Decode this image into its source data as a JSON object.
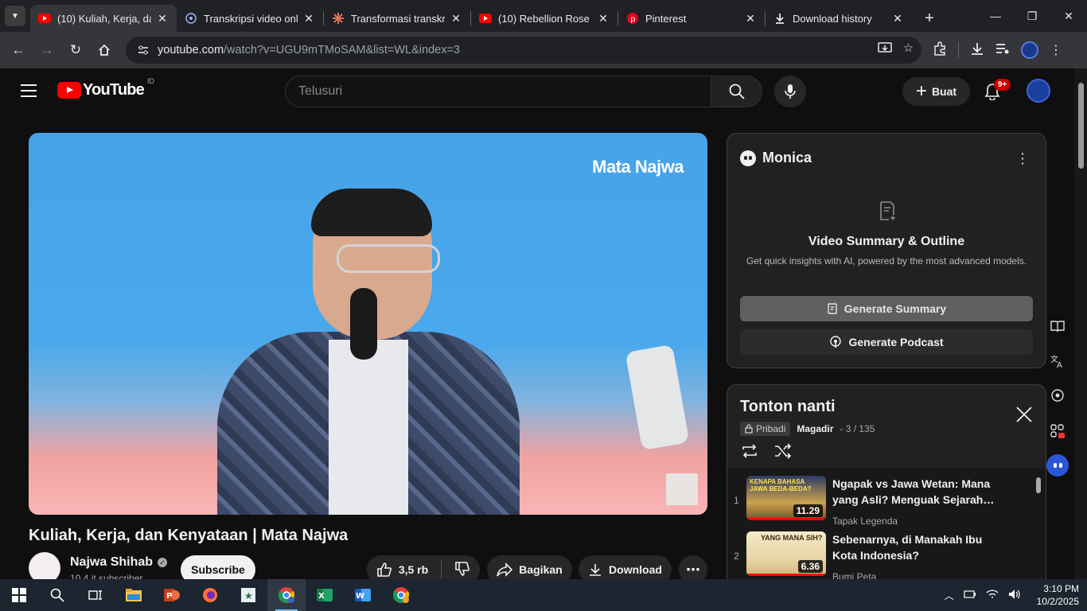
{
  "browser": {
    "tabs": [
      {
        "title": "(10) Kuliah, Kerja, dan",
        "icon": "youtube-icon",
        "active": true
      },
      {
        "title": "Transkripsi video onli",
        "icon": "transcribe-icon",
        "active": false
      },
      {
        "title": "Transformasi transkrip",
        "icon": "claude-icon",
        "active": false
      },
      {
        "title": "(10) Rebellion Rose -",
        "icon": "youtube-icon",
        "active": false
      },
      {
        "title": "Pinterest",
        "icon": "pinterest-icon",
        "active": false
      },
      {
        "title": "Download history",
        "icon": "download-icon",
        "active": false
      }
    ],
    "url_host": "youtube.com",
    "url_path": "/watch?v=UGU9mTMoSAM&list=WL&index=3"
  },
  "youtube": {
    "logo_text": "YouTube",
    "country": "ID",
    "search_placeholder": "Telusuri",
    "create_label": "Buat",
    "notif_count": "9+"
  },
  "video": {
    "watermark": "Mata Najwa",
    "title": "Kuliah, Kerja, dan Kenyataan | Mata Najwa",
    "channel": "Najwa Shihab",
    "subscribers": "10,4 jt subscriber",
    "subscribe_label": "Subscribe",
    "likes": "3,5 rb",
    "share_label": "Bagikan",
    "download_label": "Download"
  },
  "monica": {
    "name": "Monica",
    "heading": "Video Summary & Outline",
    "subtitle": "Get quick insights with AI, powered by the most advanced models.",
    "summary_btn": "Generate Summary",
    "podcast_btn": "Generate Podcast"
  },
  "playlist": {
    "title": "Tonton nanti",
    "privacy": "Pribadi",
    "owner": "Magadir",
    "position": "- 3 / 135",
    "items": [
      {
        "index": "1",
        "title": "Ngapak vs Jawa Wetan: Mana yang Asli? Menguak Sejarah…",
        "channel": "Tapak Legenda",
        "duration": "11.29",
        "thumb_text": "KENAPA BAHASA JAWA BEDA-BEDA?"
      },
      {
        "index": "2",
        "title": "Sebenarnya, di Manakah Ibu Kota Indonesia?",
        "channel": "Bumi Peta",
        "duration": "6.36",
        "thumb_text": "YANG MANA SIH?"
      }
    ]
  },
  "taskbar": {
    "time": "3:10 PM",
    "date": "10/2/2025"
  }
}
